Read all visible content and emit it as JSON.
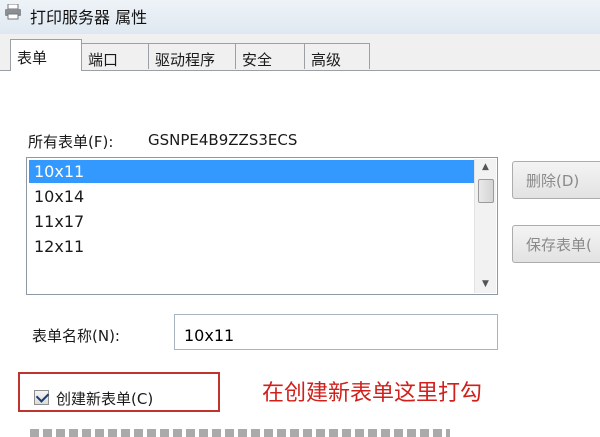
{
  "window": {
    "title": "打印服务器 属性"
  },
  "tabs": [
    {
      "label": "表单",
      "active": true
    },
    {
      "label": "端口"
    },
    {
      "label": "驱动程序"
    },
    {
      "label": "安全"
    },
    {
      "label": "高级"
    }
  ],
  "forms_section": {
    "label": "所有表单(F):",
    "server_name": "GSNPE4B9ZZS3ECS",
    "list_items": [
      "10x11",
      "10x14",
      "11x17",
      "12x11"
    ],
    "selected_item": "10x11"
  },
  "buttons": {
    "delete": "删除(D)",
    "save": "保存表单("
  },
  "form_name": {
    "label": "表单名称(N):",
    "value": "10x11"
  },
  "create_new": {
    "label": "创建新表单(C)",
    "checked": true
  },
  "annotation": {
    "text": "在创建新表单这里打勾",
    "color": "#d0201c"
  },
  "colors": {
    "selection": "#3399ff",
    "highlight_border": "#c0342e"
  }
}
